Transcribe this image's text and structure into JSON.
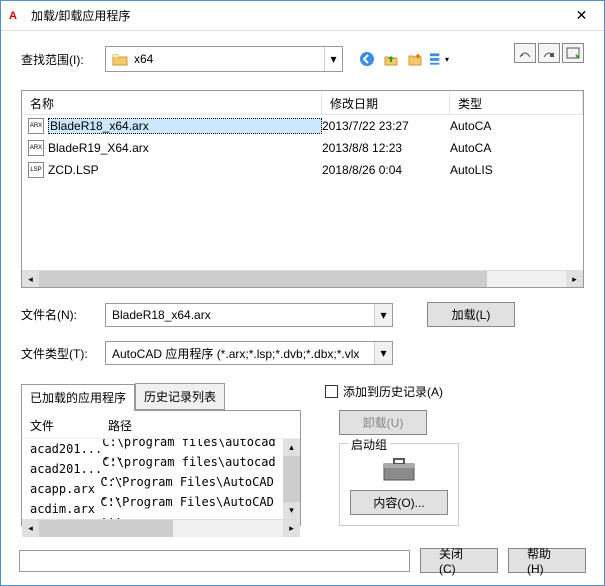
{
  "title": "加载/卸载应用程序",
  "lookIn": {
    "label": "查找范围(I):",
    "value": "x64"
  },
  "columns": {
    "name": "名称",
    "date": "修改日期",
    "type": "类型"
  },
  "files": [
    {
      "icon": "ARX",
      "name": "BladeR18_x64.arx",
      "date": "2013/7/22 23:27",
      "type": "AutoCA",
      "selected": true
    },
    {
      "icon": "ARX",
      "name": "BladeR19_X64.arx",
      "date": "2013/8/8 12:23",
      "type": "AutoCA",
      "selected": false
    },
    {
      "icon": "LSP",
      "name": "ZCD.LSP",
      "date": "2018/8/26 0:04",
      "type": "AutoLIS",
      "selected": false
    }
  ],
  "fileName": {
    "label": "文件名(N):",
    "value": "BladeR18_x64.arx"
  },
  "fileType": {
    "label": "文件类型(T):",
    "value": "AutoCAD 应用程序 (*.arx;*.lsp;*.dvb;*.dbx;*.vlx"
  },
  "loadBtn": "加载(L)",
  "tabs": {
    "loaded": "已加载的应用程序",
    "history": "历史记录列表"
  },
  "miniCols": {
    "file": "文件",
    "path": "路径"
  },
  "loadedList": [
    {
      "file": "acad201...",
      "path": "C:\\program files\\autocad ..."
    },
    {
      "file": "acad201...",
      "path": "C:\\program files\\autocad ..."
    },
    {
      "file": "acapp.arx",
      "path": "C:\\Program Files\\AutoCAD ..."
    },
    {
      "file": "acdim.arx",
      "path": "C:\\Program Files\\AutoCAD ..."
    }
  ],
  "addHistory": "添加到历史记录(A)",
  "unloadBtn": "卸载(U)",
  "startup": {
    "title": "启动组",
    "contents": "内容(O)..."
  },
  "closeBtn": "关闭(C)",
  "helpBtn": "帮助(H)"
}
